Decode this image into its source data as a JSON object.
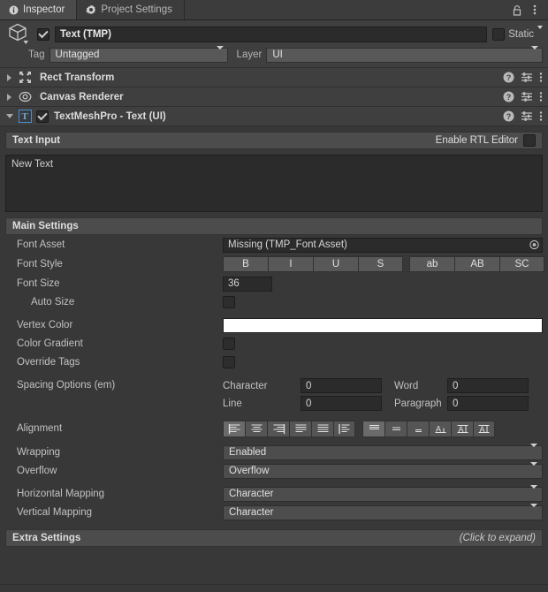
{
  "window": {
    "tabs": [
      {
        "label": "Inspector",
        "icon": "info-icon",
        "active": true
      },
      {
        "label": "Project Settings",
        "icon": "gear-icon",
        "active": false
      }
    ],
    "lock_icon": "lock-icon",
    "menu_icon": "kebab-menu-icon"
  },
  "object_header": {
    "enabled_checkbox": true,
    "object_icon": "cube-icon",
    "name_value": "Text (TMP)",
    "static_label": "Static",
    "static_checked": false,
    "tag_label": "Tag",
    "tag_value": "Untagged",
    "layer_label": "Layer",
    "layer_value": "UI"
  },
  "components": [
    {
      "title": "Rect Transform",
      "icon": "rect-transform-icon",
      "expanded": false,
      "has_enable_checkbox": false
    },
    {
      "title": "Canvas Renderer",
      "icon": "canvas-renderer-icon",
      "expanded": false,
      "has_enable_checkbox": false
    },
    {
      "title": "TextMeshPro - Text (UI)",
      "icon": "tmp-text-icon",
      "expanded": true,
      "has_enable_checkbox": true,
      "enabled": true
    }
  ],
  "component_row_icons": {
    "help": "help-icon",
    "preset": "preset-sliders-icon",
    "menu": "kebab-menu-icon"
  },
  "text_input": {
    "section_title": "Text Input",
    "rtl_label": "Enable RTL Editor",
    "rtl_checked": false,
    "text_value": "New Text"
  },
  "main_settings": {
    "section_title": "Main Settings",
    "font_asset": {
      "label": "Font Asset",
      "value": "Missing (TMP_Font Asset)",
      "picker_icon": "object-picker-icon"
    },
    "font_style": {
      "label": "Font Style",
      "group1": [
        "B",
        "I",
        "U",
        "S"
      ],
      "group2": [
        "ab",
        "AB",
        "SC"
      ]
    },
    "font_size": {
      "label": "Font Size",
      "value": "36"
    },
    "auto_size": {
      "label": "Auto Size",
      "checked": false
    },
    "vertex_color": {
      "label": "Vertex Color",
      "value": "#FFFFFF"
    },
    "color_gradient": {
      "label": "Color Gradient",
      "checked": false
    },
    "override_tags": {
      "label": "Override Tags",
      "checked": false
    },
    "spacing": {
      "label": "Spacing Options (em)",
      "character": {
        "label": "Character",
        "value": "0"
      },
      "word": {
        "label": "Word",
        "value": "0"
      },
      "line": {
        "label": "Line",
        "value": "0"
      },
      "paragraph": {
        "label": "Paragraph",
        "value": "0"
      }
    },
    "alignment": {
      "label": "Alignment",
      "horizontal": [
        {
          "name": "align-left-icon",
          "selected": true
        },
        {
          "name": "align-center-icon",
          "selected": false
        },
        {
          "name": "align-right-icon",
          "selected": false
        },
        {
          "name": "align-justified-icon",
          "selected": false
        },
        {
          "name": "align-flush-icon",
          "selected": false
        },
        {
          "name": "align-geometry-center-icon",
          "selected": false
        }
      ],
      "vertical": [
        {
          "name": "align-top-icon",
          "selected": true
        },
        {
          "name": "align-middle-icon",
          "selected": false
        },
        {
          "name": "align-bottom-icon",
          "selected": false
        },
        {
          "name": "align-baseline-icon",
          "selected": false
        },
        {
          "name": "align-midline-icon",
          "selected": false
        },
        {
          "name": "align-capline-icon",
          "selected": false
        }
      ]
    },
    "wrapping": {
      "label": "Wrapping",
      "value": "Enabled"
    },
    "overflow": {
      "label": "Overflow",
      "value": "Overflow"
    },
    "horizontal_mapping": {
      "label": "Horizontal Mapping",
      "value": "Character"
    },
    "vertical_mapping": {
      "label": "Vertical Mapping",
      "value": "Character"
    }
  },
  "extra_settings": {
    "section_title": "Extra Settings",
    "hint": "(Click to expand)"
  }
}
